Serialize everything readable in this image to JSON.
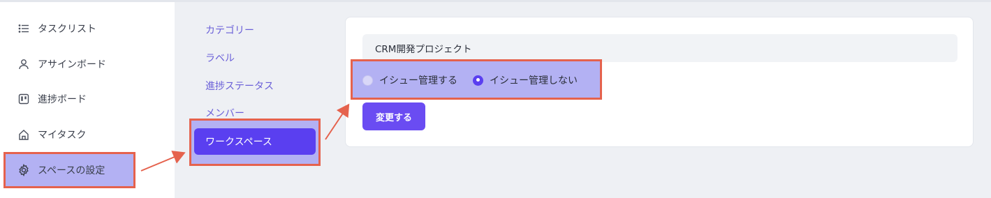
{
  "sidebar": {
    "items": [
      {
        "label": "タスクリスト",
        "icon": "list-icon"
      },
      {
        "label": "アサインボード",
        "icon": "user-icon"
      },
      {
        "label": "進捗ボード",
        "icon": "board-icon"
      },
      {
        "label": "マイタスク",
        "icon": "home-icon"
      },
      {
        "label": "スペースの設定",
        "icon": "gear-icon"
      }
    ]
  },
  "subnav": {
    "items": [
      {
        "label": "カテゴリー"
      },
      {
        "label": "ラベル"
      },
      {
        "label": "進捗ステータス"
      },
      {
        "label": "メンバー"
      },
      {
        "label": "ワークスペース"
      }
    ]
  },
  "workspace": {
    "project_name": "CRM開発プロジェクト",
    "radio_options": [
      {
        "label": "イシュー管理する",
        "checked": false
      },
      {
        "label": "イシュー管理しない",
        "checked": true
      }
    ],
    "submit_label": "変更する"
  },
  "colors": {
    "accent": "#5a3ff0",
    "highlight": "#b3b1f3",
    "annotation": "#e5624d"
  }
}
